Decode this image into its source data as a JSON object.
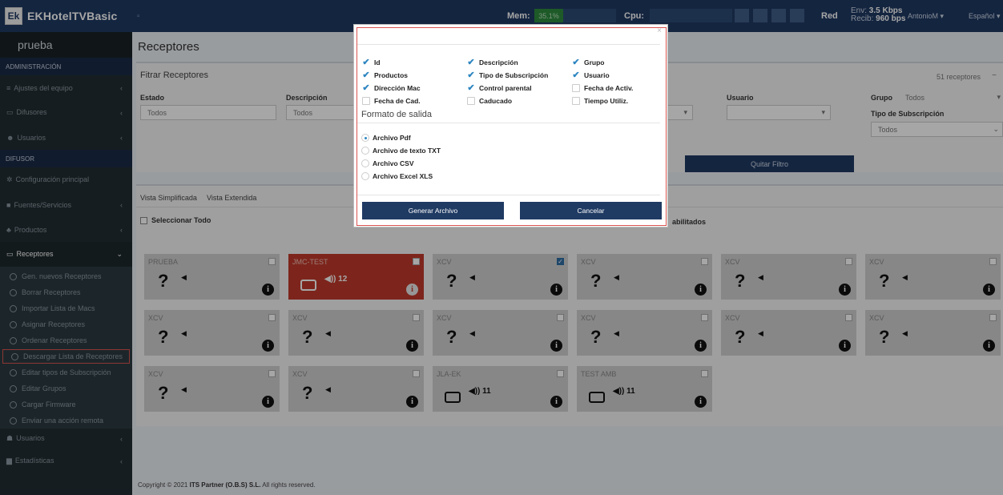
{
  "app": {
    "logo_box": "Ek",
    "logo_text": "EKHotelTVBasic"
  },
  "topbar": {
    "mem_label": "Mem:",
    "mem_value": "35.1%",
    "cpu_label": "Cpu:",
    "red_label": "Red",
    "env_label": "Env:",
    "env_value": "3.5 Kbps",
    "recib_label": "Recib:",
    "recib_value": "960 bps",
    "user": "AntonioM ▾",
    "language": "Español ▾"
  },
  "sidebar": {
    "title": "prueba",
    "admin_header": "ADMINISTRACIÓN",
    "admin_items": [
      {
        "label": "Ajustes del equipo",
        "icon": "≡"
      },
      {
        "label": "Difusores",
        "icon": "▭"
      },
      {
        "label": "Usuarios",
        "icon": "☻"
      }
    ],
    "difusor_header": "DIFUSOR",
    "difusor_items": [
      {
        "label": "Configuración principal",
        "icon": "✲"
      },
      {
        "label": "Fuentes/Servicios",
        "icon": "■"
      },
      {
        "label": "Productos",
        "icon": "♣"
      }
    ],
    "active_item": {
      "label": "Receptores",
      "icon": "▭"
    },
    "sub_items": [
      "Gen. nuevos Receptores",
      "Borrar Receptores",
      "Importar Lista de Macs",
      "Asignar Receptores",
      "Ordenar Receptores",
      "Descargar Lista de Receptores",
      "Editar tipos de Subscripción",
      "Editar Grupos",
      "Cargar Firmware",
      "Enviar una acción remota"
    ],
    "bottom_items": [
      {
        "label": "Usuarios",
        "icon": "☗"
      },
      {
        "label": "Estadísticas",
        "icon": "▆"
      }
    ]
  },
  "main": {
    "title": "Receptores",
    "filter": {
      "title": "Fitrar Receptores",
      "count": "51 receptores",
      "estado_label": "Estado",
      "estado_value": "Todos",
      "descripcion_label": "Descripción",
      "descripcion_value": "Todos",
      "usuario_label": "Usuario",
      "usuario_value": "",
      "grupo_label": "Grupo",
      "grupo_value": "Todos",
      "tipo_label": "Tipo de Subscripción",
      "tipo_value": "Todos",
      "quitar": "Quitar Filtro"
    },
    "tabs": [
      "Vista Simplificada",
      "Vista Extendida"
    ],
    "select_all": "Seleccionar Todo",
    "habilitados": "abilitados",
    "cards": [
      {
        "name": "PRUEBA",
        "type": "unknown",
        "checked": false
      },
      {
        "name": "JMC-TEST",
        "type": "device",
        "channel": "12",
        "checked": false,
        "red": true
      },
      {
        "name": "XCV",
        "type": "unknown",
        "checked": true
      },
      {
        "name": "XCV",
        "type": "unknown",
        "checked": false
      },
      {
        "name": "XCV",
        "type": "unknown",
        "checked": false
      },
      {
        "name": "XCV",
        "type": "unknown",
        "checked": false
      },
      {
        "name": "XCV",
        "type": "unknown",
        "checked": false
      },
      {
        "name": "XCV",
        "type": "unknown",
        "checked": false
      },
      {
        "name": "XCV",
        "type": "unknown",
        "checked": false
      },
      {
        "name": "XCV",
        "type": "unknown",
        "checked": false
      },
      {
        "name": "XCV",
        "type": "unknown",
        "checked": false
      },
      {
        "name": "XCV",
        "type": "unknown",
        "checked": false
      },
      {
        "name": "XCV",
        "type": "unknown",
        "checked": false
      },
      {
        "name": "XCV",
        "type": "unknown",
        "checked": false
      },
      {
        "name": "JLA-EK",
        "type": "device",
        "channel": "11",
        "checked": false
      },
      {
        "name": "TEST AMB",
        "type": "device",
        "channel": "11",
        "checked": false
      }
    ],
    "footer_prefix": "Copyright © 2021 ",
    "footer_company": "ITS Partner (O.B.S) S.L.",
    "footer_suffix": " All rights reserved."
  },
  "modal": {
    "close": "×",
    "columns": [
      {
        "label": "Id",
        "checked": true
      },
      {
        "label": "Descripción",
        "checked": true
      },
      {
        "label": "Grupo",
        "checked": true
      },
      {
        "label": "Productos",
        "checked": true
      },
      {
        "label": "Tipo de Subscripción",
        "checked": true
      },
      {
        "label": "Usuario",
        "checked": true
      },
      {
        "label": "Dirección Mac",
        "checked": true
      },
      {
        "label": "Control parental",
        "checked": true
      },
      {
        "label": "Fecha de Activ.",
        "checked": false
      },
      {
        "label": "Fecha de Cad.",
        "checked": false
      },
      {
        "label": "Caducado",
        "checked": false
      },
      {
        "label": "Tiempo Utiliz.",
        "checked": false
      }
    ],
    "format_title": "Formato de salida",
    "formats": [
      {
        "label": "Archivo Pdf",
        "selected": true
      },
      {
        "label": "Archivo de texto TXT",
        "selected": false
      },
      {
        "label": "Archivo CSV",
        "selected": false
      },
      {
        "label": "Archivo Excel XLS",
        "selected": false
      }
    ],
    "generate": "Generar Archivo",
    "cancel": "Cancelar"
  }
}
